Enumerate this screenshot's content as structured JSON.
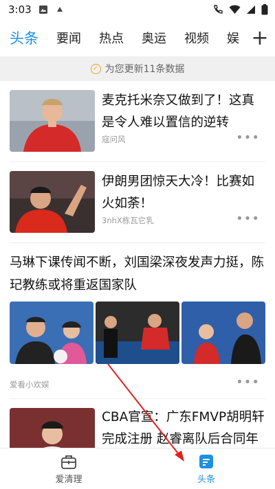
{
  "status_bar": {
    "time": "3:03"
  },
  "tabs": [
    {
      "label": "头条",
      "active": true
    },
    {
      "label": "要闻"
    },
    {
      "label": "热点"
    },
    {
      "label": "奥运"
    },
    {
      "label": "视频"
    },
    {
      "label": "娱"
    }
  ],
  "add_tab": "+",
  "notice": {
    "text": "为您更新11条数据"
  },
  "articles": [
    {
      "title": "麦克托米奈又做到了！这真是令人难以置信的逆转",
      "source": "寇问风"
    },
    {
      "title": "伊朗男团惊天大冷！比赛如火如荼！",
      "source": "3nhX栋瓦它乳"
    },
    {
      "title": "马琳下课传闻不断，刘国梁深夜发声力挺，陈玘教练或将重返国家队",
      "source": "爱看小欢娱"
    },
    {
      "title": "CBA官宣：广东FMVP胡明轩完成注册 赵睿离队后合同年"
    }
  ],
  "more_label": "•••",
  "bottom_nav": [
    {
      "label": "爱清理"
    },
    {
      "label": "头条",
      "active": true
    }
  ],
  "colors": {
    "accent": "#1e8fe1",
    "annotation_arrow": "#e02020"
  }
}
